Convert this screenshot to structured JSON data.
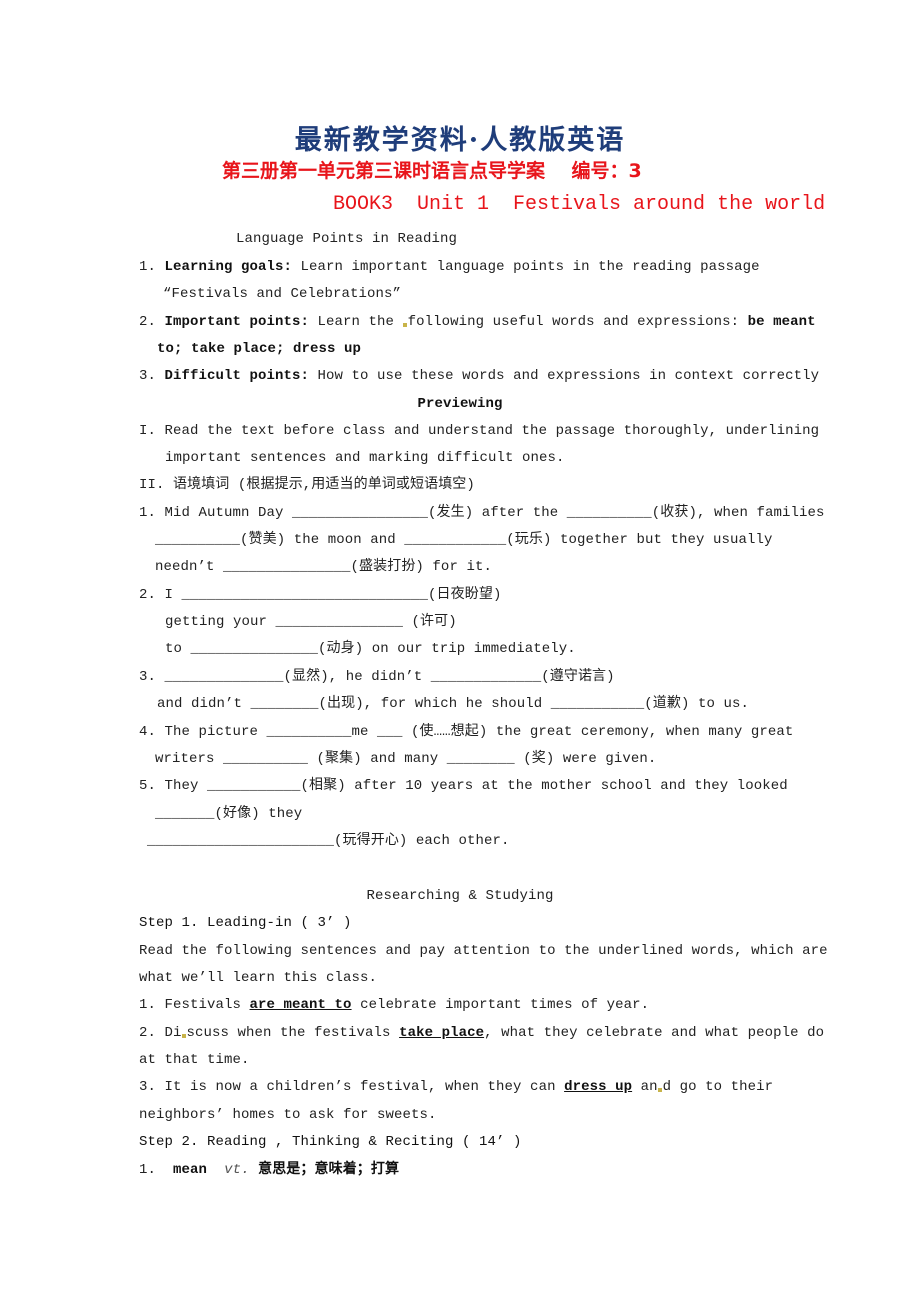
{
  "header": {
    "banner": "最新教学资料·人教版英语",
    "subtitle": "第三册第一单元第三课时语言点导学案    编号：3",
    "title_en": "BOOK3  Unit 1  Festivals around the world",
    "section_heading": "Language Points in Reading"
  },
  "goals": [
    {
      "num": "1. ",
      "label": "Learning goals:",
      "text": " Learn important language points in the reading passage",
      "cont": "“Festivals and Celebrations”"
    },
    {
      "num": "2. ",
      "label": "Important points:",
      "text_a": " Learn the ",
      "text_b": "following useful words and expressions: ",
      "bold_tail": "be meant",
      "cont": "to; take place; dress up"
    },
    {
      "num": "3. ",
      "label": "Difficult points:",
      "text": " How to use these words and expressions in context correctly"
    }
  ],
  "previewing": {
    "heading": "Previewing",
    "item1_line1": "I. Read the text before class and understand the passage thoroughly, underlining",
    "item1_line2": "important sentences and marking difficult ones.",
    "item2": "II. 语境填词 (根据提示,用适当的单词或短语填空)",
    "exercises": [
      "1. Mid Autumn Day ________________(发生) after the __________(收获), when families",
      "__________(赞美) the moon and ____________(玩乐) together but they usually",
      "needn’t _______________(盛装打扮) for it.",
      "2. I _____________________________(日夜盼望)",
      "getting your _______________ (许可)",
      "to _______________(动身) on our trip immediately.",
      "3. ______________(显然), he didn’t _____________(遵守诺言)",
      "and didn’t ________(出现), for which he should ___________(道歉) to us.",
      "4. The picture __________me ___ (使……想起) the great ceremony, when many great",
      "writers __________ (聚集) and many ________ (奖) were given.",
      "5. They ___________(相聚) after 10 years at the mother school and they looked",
      "_______(好像) they",
      "______________________(玩得开心) each other."
    ]
  },
  "researching": {
    "heading": "Researching & Studying",
    "step1": "Step 1. Leading-in ( 3’ )",
    "intro_line1": "Read the following sentences and pay attention to the underlined words, which are",
    "intro_line2": "what we’ll learn this class.",
    "s1_pre": "1. Festivals ",
    "s1_ul": "are meant to",
    "s1_post": " celebrate important times of year.",
    "s2_pre_a": "2. Di",
    "s2_pre_b": "scuss when the festivals ",
    "s2_ul": "take place",
    "s2_post": ", what they celebrate and what people do",
    "s2_cont": "at that time.",
    "s3_pre": "3. It is now a children’s festival, when they can ",
    "s3_ul": "dress up",
    "s3_post_a": " an",
    "s3_post_b": "d go to their",
    "s3_cont": "neighbors’ homes to ask for sweets.",
    "step2": "Step 2. Reading , Thinking & Reciting ( 14’ )",
    "vocab_num": "1. ",
    "vocab_word": "mean",
    "vocab_pos": "vt.",
    "vocab_meaning": "意思是；意味着；打算"
  }
}
